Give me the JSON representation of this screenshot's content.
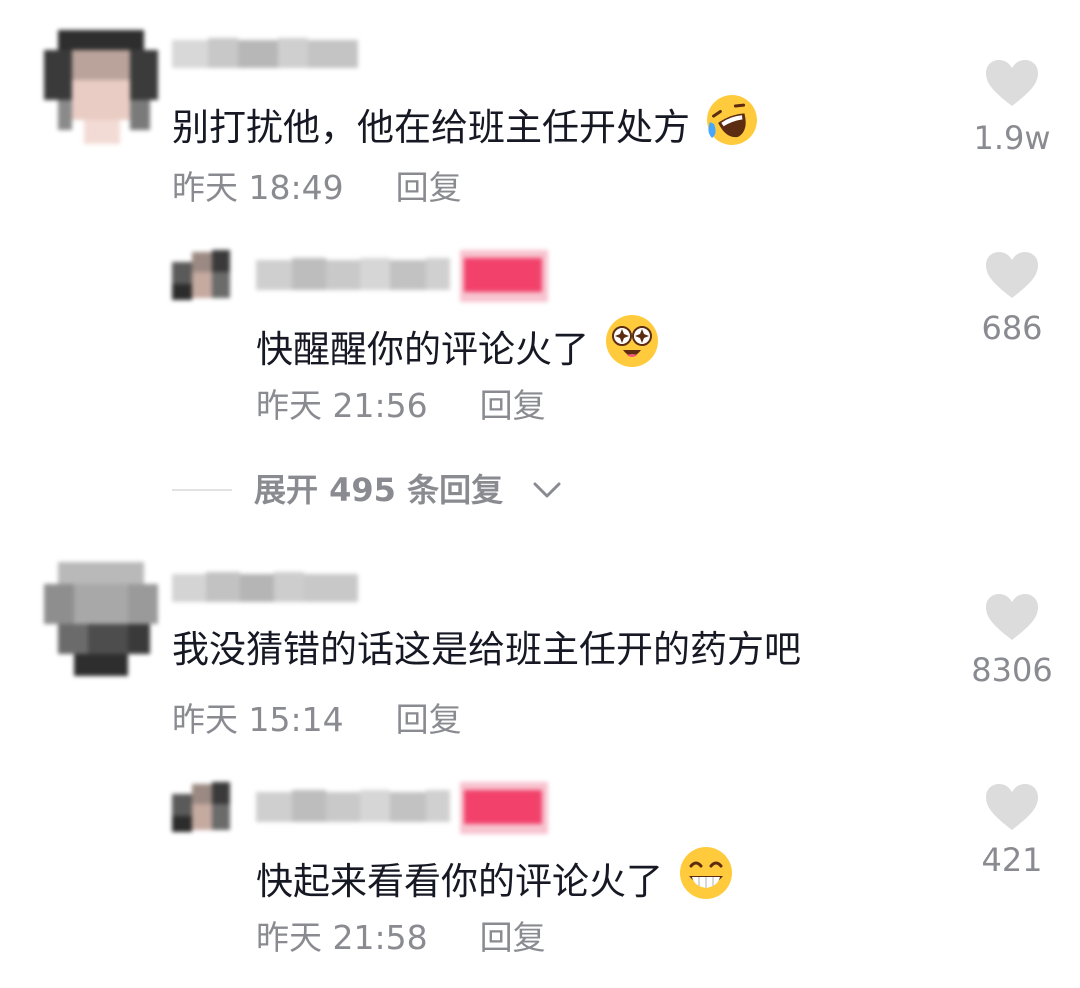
{
  "comments": [
    {
      "text": "别打扰他，他在给班主任开处方",
      "time": "昨天 18:49",
      "reply_label": "回复",
      "likes": "1.9w",
      "emoji": "rolling-laugh-icon",
      "replies": [
        {
          "text": "快醒醒你的评论火了",
          "time": "昨天 21:56",
          "reply_label": "回复",
          "likes": "686",
          "emoji": "star-eyes-icon"
        }
      ],
      "expand": {
        "label": "展开 495 条回复",
        "icon": "chevron-down-icon"
      }
    },
    {
      "text": "我没猜错的话这是给班主任开的药方吧",
      "time": "昨天 15:14",
      "reply_label": "回复",
      "likes": "8306",
      "replies": [
        {
          "text": "快起来看看你的评论火了",
          "time": "昨天 21:58",
          "reply_label": "回复",
          "likes": "421",
          "emoji": "grin-icon"
        }
      ]
    }
  ],
  "colors": {
    "text": "#161823",
    "meta": "#8a8b91",
    "heart": "#dcdcdc",
    "author_badge": "#f2426b"
  }
}
